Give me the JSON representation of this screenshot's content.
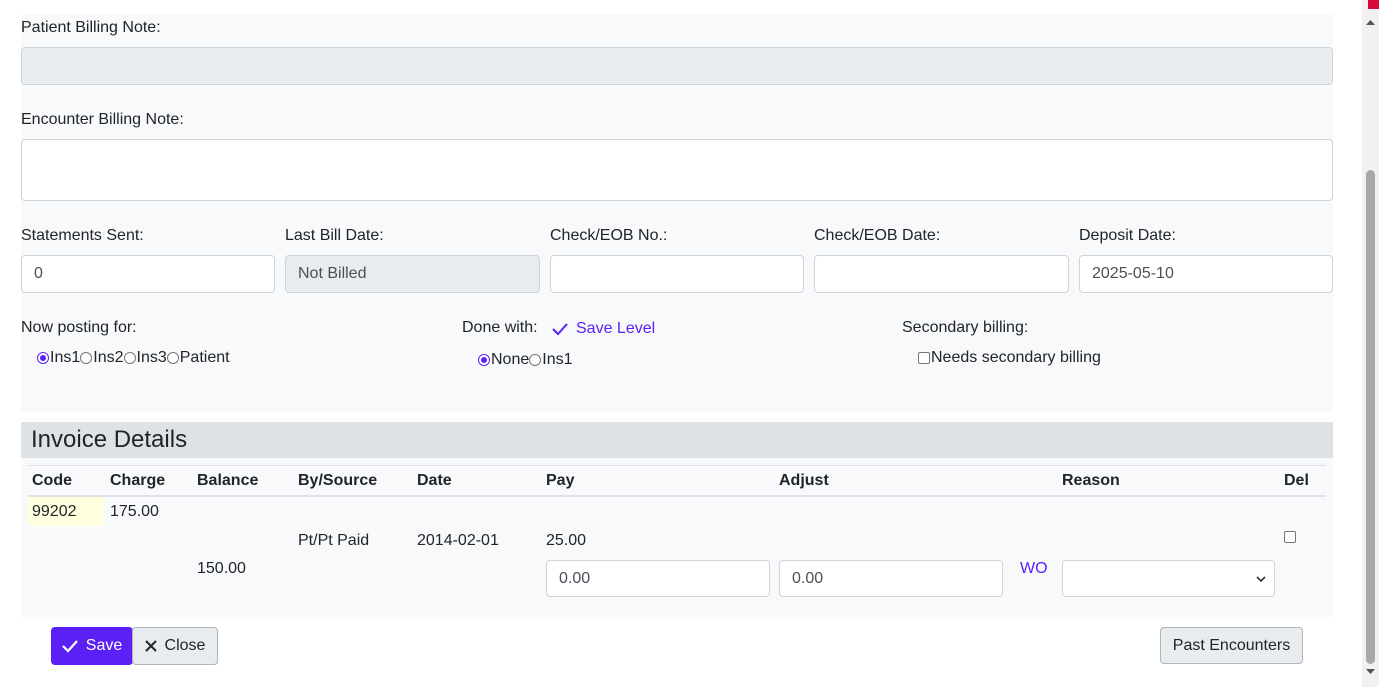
{
  "billing": {
    "patient_note_label": "Patient Billing Note:",
    "patient_note_value": "",
    "encounter_note_label": "Encounter Billing Note:",
    "encounter_note_value": ""
  },
  "fields": {
    "statements_sent_label": "Statements Sent:",
    "statements_sent_value": "0",
    "last_bill_date_label": "Last Bill Date:",
    "last_bill_date_value": "Not Billed",
    "check_no_label": "Check/EOB No.:",
    "check_no_value": "",
    "check_date_label": "Check/EOB Date:",
    "check_date_value": "",
    "deposit_date_label": "Deposit Date:",
    "deposit_date_value": "2025-05-10"
  },
  "posting": {
    "label": "Now posting for:",
    "options": [
      "Ins1",
      "Ins2",
      "Ins3",
      "Patient"
    ],
    "selected": "Ins1"
  },
  "done_with": {
    "label": "Done with:",
    "save_level_label": "Save Level",
    "options": [
      "None",
      "Ins1"
    ],
    "selected": "None"
  },
  "secondary": {
    "label": "Secondary billing:",
    "checkbox_label": "Needs secondary billing",
    "checked": false
  },
  "invoice": {
    "title": "Invoice Details",
    "columns": [
      "Code",
      "Charge",
      "Balance",
      "By/Source",
      "Date",
      "Pay",
      "Adjust",
      "Reason",
      "Del"
    ],
    "code": "99202",
    "charge": "175.00",
    "source": "Pt/Pt Paid",
    "date": "2014-02-01",
    "paid": "25.00",
    "balance": "150.00",
    "pay_input": "0.00",
    "adjust_input": "0.00",
    "wo_label": "WO",
    "reason_value": ""
  },
  "actions": {
    "save_label": "Save",
    "close_label": "Close",
    "past_encounters_label": "Past Encounters"
  },
  "colors": {
    "accent": "#5b20f5",
    "code_highlight": "#ffffe0"
  }
}
